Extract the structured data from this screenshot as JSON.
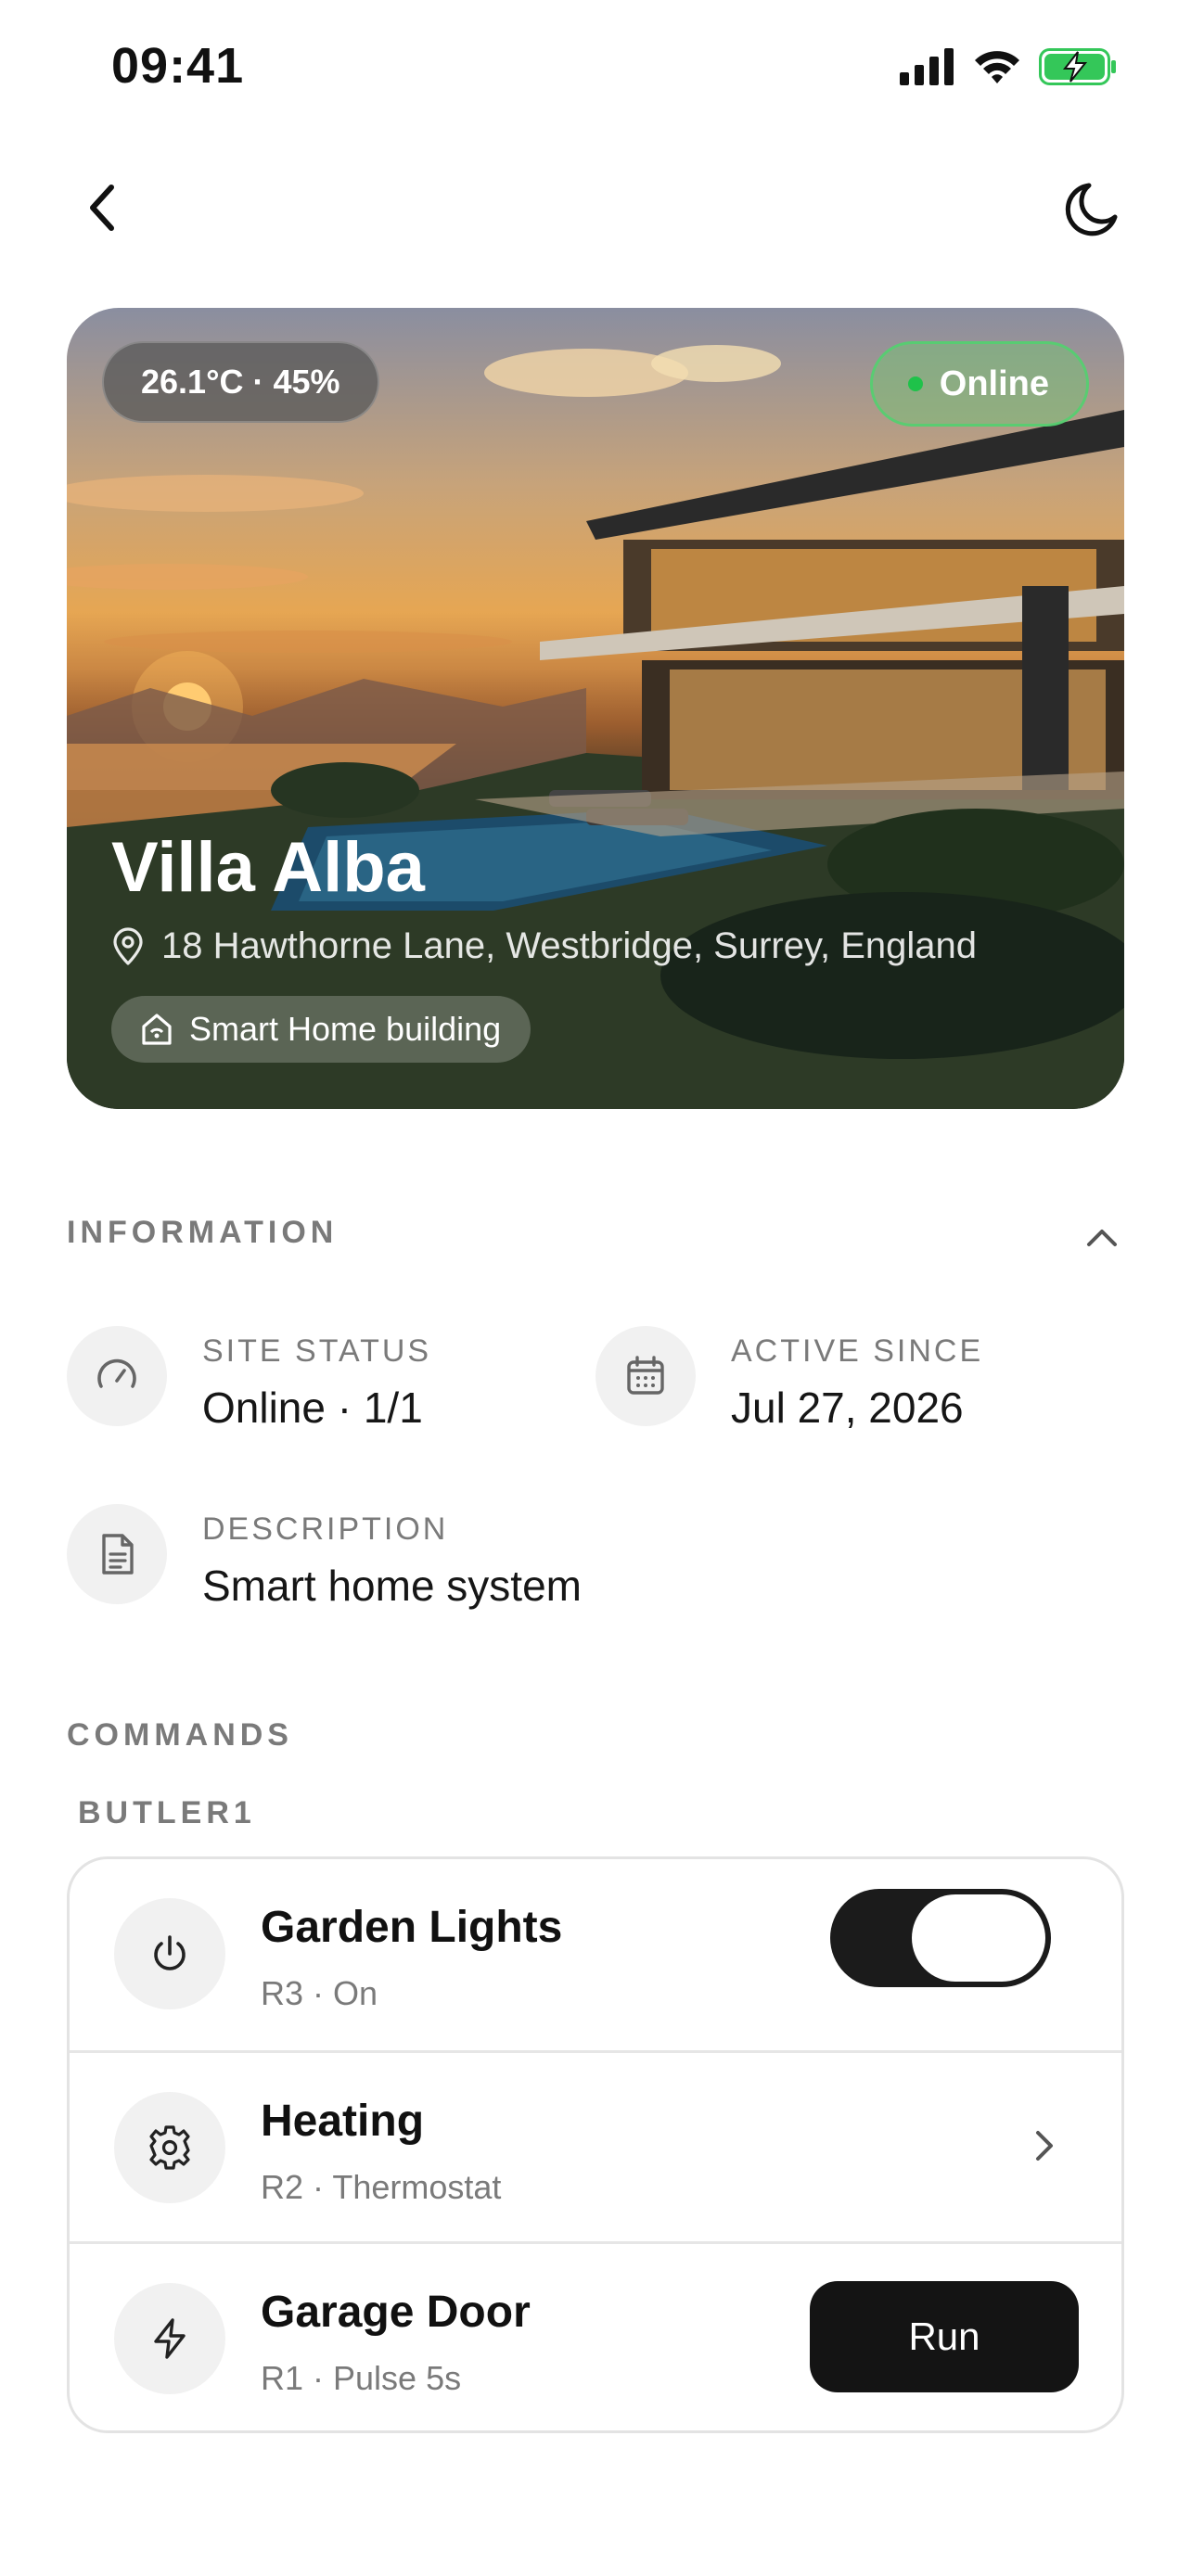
{
  "status_bar": {
    "time": "09:41",
    "icons": [
      "cellular-signal-icon",
      "wifi-icon",
      "battery-charging-icon"
    ]
  },
  "nav": {
    "back_icon": "chevron-left-icon",
    "theme_icon": "moon-icon"
  },
  "hero": {
    "weather": "26.1°C · 45%",
    "status": "Online",
    "title": "Villa Alba",
    "address": "18 Hawthorne Lane, Westbridge, Surrey, England",
    "type": "Smart Home building",
    "colors": {
      "online_dot": "#1fc24a"
    }
  },
  "information": {
    "label": "INFORMATION",
    "items": [
      {
        "icon": "gauge-icon",
        "label": "SITE STATUS",
        "value": "Online · 1/1"
      },
      {
        "icon": "calendar-icon",
        "label": "ACTIVE SINCE",
        "value": "Jul 27, 2026"
      },
      {
        "icon": "document-icon",
        "label": "DESCRIPTION",
        "value": "Smart home system"
      }
    ]
  },
  "commands": {
    "label": "COMMANDS",
    "group": "BUTLER1",
    "items": [
      {
        "icon": "power-icon",
        "title": "Garden Lights",
        "subtitle": "R3 · On",
        "control": "toggle",
        "toggle_on": true
      },
      {
        "icon": "gear-icon",
        "title": "Heating",
        "subtitle": "R2 · Thermostat",
        "control": "chevron"
      },
      {
        "icon": "lightning-icon",
        "title": "Garage Door",
        "subtitle": "R1 · Pulse 5s",
        "control": "button",
        "button_label": "Run"
      }
    ]
  }
}
